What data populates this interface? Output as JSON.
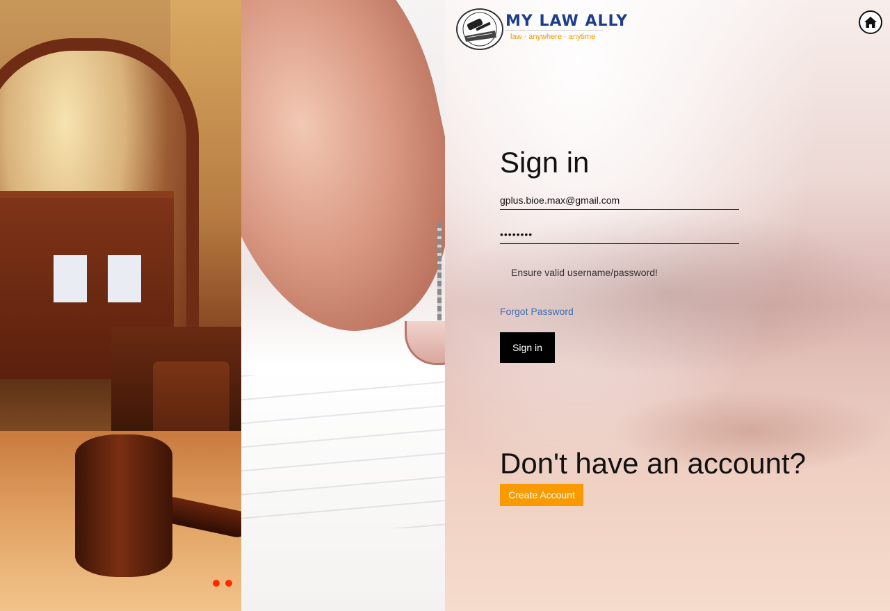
{
  "brand": {
    "name": "MY LAW ALLY",
    "tagline": "law · anywhere · anytime",
    "primary_color": "#1f3e8a",
    "accent_color": "#f29a00"
  },
  "header": {
    "home_icon": "home-icon"
  },
  "carousel": {
    "dot_count": 2,
    "dot_color": "#ff2a00"
  },
  "signin": {
    "title": "Sign in",
    "email_value": "gplus.bioe.max@gmail.com",
    "password_value": "••••••••",
    "error_message": "Ensure valid username/password!",
    "forgot_label": "Forgot Password",
    "submit_label": "Sign in"
  },
  "register": {
    "heading": "Don't have an account?",
    "button_label": "Create Account",
    "button_color": "#f89a00"
  }
}
